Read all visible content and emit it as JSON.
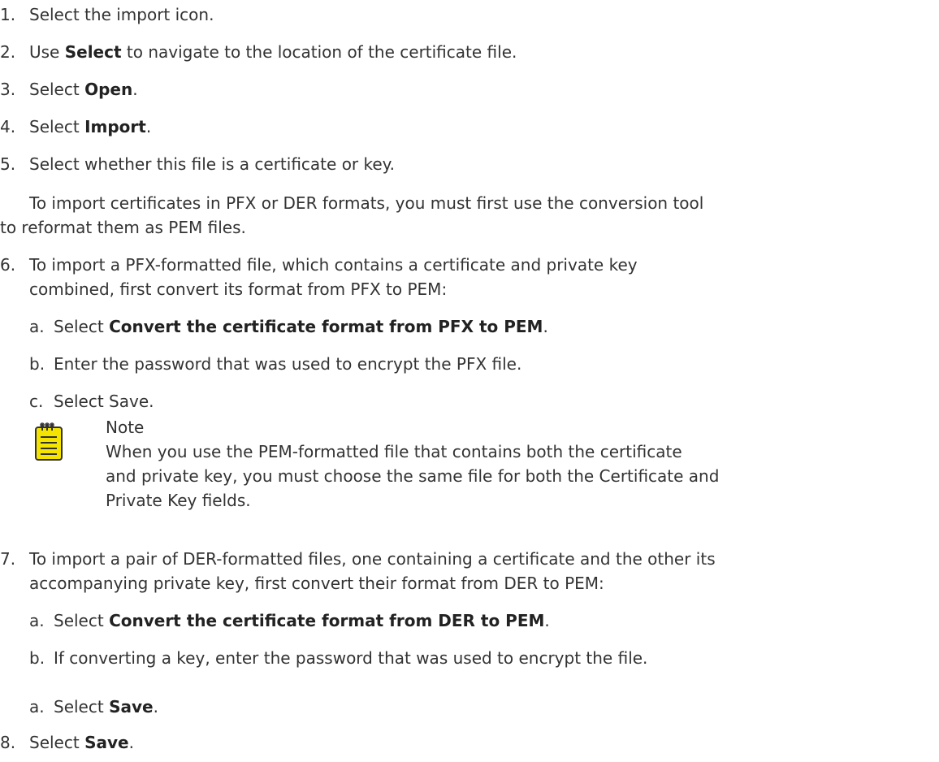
{
  "steps": [
    {
      "num": "1.",
      "pre": "Select the import icon.",
      "bold": "",
      "post": ""
    },
    {
      "num": "2.",
      "pre": "Use ",
      "bold": "Select",
      "post": " to navigate to the location of the certificate file."
    },
    {
      "num": "3.",
      "pre": "Select ",
      "bold": "Open",
      "post": "."
    },
    {
      "num": "4.",
      "pre": "Select ",
      "bold": "Import",
      "post": "."
    },
    {
      "num": "5.",
      "pre": "Select whether this file is a certificate or key.",
      "bold": "",
      "post": ""
    }
  ],
  "step5_para": {
    "line1": "To import certificates in PFX or DER formats, you must first use the conversion tool",
    "line2": "to reformat them as PEM files."
  },
  "step6": {
    "num": "6.",
    "line1": "To import a PFX-formatted file, which contains a certificate and private key",
    "line2": "combined, first convert its format from PFX to PEM:",
    "substeps": [
      {
        "letter": "a.",
        "pre": "Select ",
        "bold": "Convert the certificate format from PFX to PEM",
        "post": "."
      },
      {
        "letter": "b.",
        "pre": "Enter the password that was used to encrypt the PFX file.",
        "bold": "",
        "post": ""
      },
      {
        "letter": "c.",
        "pre": "Select Save.",
        "bold": "",
        "post": ""
      }
    ]
  },
  "note": {
    "icon": "note-icon",
    "title": "Note",
    "line1": "When you use the PEM-formatted file that contains both the certificate",
    "line2": "and private key, you must choose the same file for both the Certificate and",
    "line3": "Private Key fields.",
    "icon_color": "#f5e400"
  },
  "step7": {
    "num": "7.",
    "line1": "To import a pair of DER-formatted files, one containing a certificate and the other its",
    "line2": "accompanying private key, first convert their format from DER to PEM:",
    "substeps": [
      {
        "letter": "a.",
        "pre": "Select ",
        "bold": "Convert the certificate format from DER to PEM",
        "post": "."
      },
      {
        "letter": "b.",
        "pre": "If converting a key, enter the password that was used to encrypt the file.",
        "bold": "",
        "post": ""
      },
      {
        "letter": "a.",
        "pre": "Select ",
        "bold": "Save",
        "post": "."
      }
    ]
  },
  "step8": {
    "num": "8.",
    "pre": "Select ",
    "bold": "Save",
    "post": "."
  }
}
